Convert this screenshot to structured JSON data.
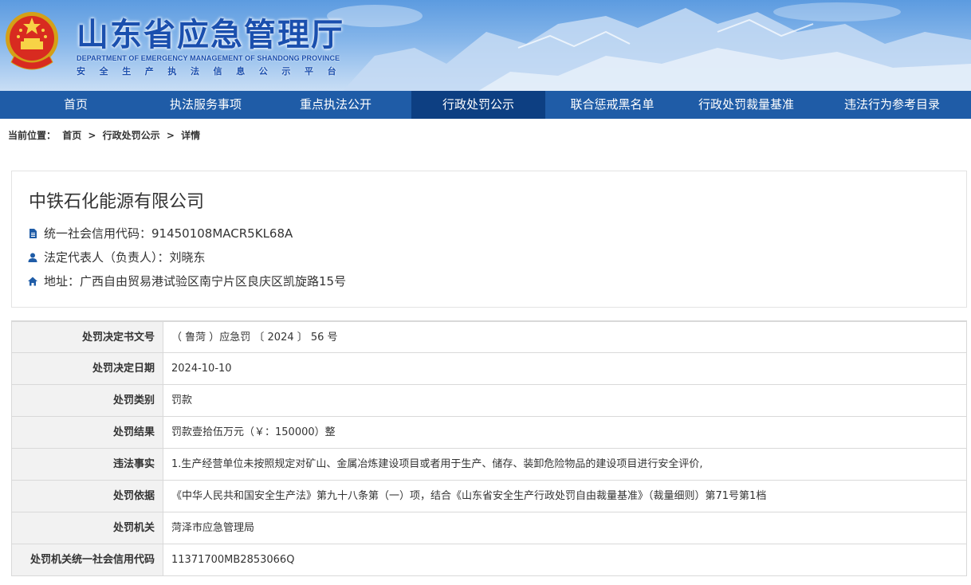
{
  "header": {
    "title_cn": "山东省应急管理厅",
    "title_en": "DEPARTMENT OF EMERGENCY MANAGEMENT OF SHANDONG PROVINCE",
    "subtitle": "安全生产执法信息公示平台",
    "brand_color": "#1a4fae"
  },
  "nav": {
    "items": [
      {
        "label": "首页"
      },
      {
        "label": "执法服务事项"
      },
      {
        "label": "重点执法公开"
      },
      {
        "label": "行政处罚公示"
      },
      {
        "label": "联合惩戒黑名单"
      },
      {
        "label": "行政处罚裁量基准"
      },
      {
        "label": "违法行为参考目录"
      }
    ],
    "active_index": 3,
    "bg_color": "#1f5ca7",
    "active_color": "#0d3f82"
  },
  "breadcrumb": {
    "prefix": "当前位置：",
    "items": [
      "首页",
      "行政处罚公示",
      "详情"
    ],
    "separator": ">"
  },
  "company": {
    "name": "中铁石化能源有限公司",
    "credit_code": "统一社会信用代码：91450108MACR5KL68A",
    "legal_rep": "法定代表人（负责人）：刘晓东",
    "address": "地址：广西自由贸易港试验区南宁片区良庆区凯旋路15号",
    "icons": [
      "document-icon",
      "user-icon",
      "home-icon"
    ]
  },
  "details": [
    {
      "key": "处罚决定书文号",
      "value": "（ 鲁菏 ）应急罚 〔 2024 〕 56 号"
    },
    {
      "key": "处罚决定日期",
      "value": "2024-10-10"
    },
    {
      "key": "处罚类别",
      "value": "罚款"
    },
    {
      "key": "处罚结果",
      "value": "罚款壹拾伍万元（￥：150000）整"
    },
    {
      "key": "违法事实",
      "value": "1.生产经营单位未按照规定对矿山、金属冶炼建设项目或者用于生产、储存、装卸危险物品的建设项目进行安全评价,"
    },
    {
      "key": "处罚依据",
      "value": "《中华人民共和国安全生产法》第九十八条第（一）项，结合《山东省安全生产行政处罚自由裁量基准》（裁量细则）第71号第1档"
    },
    {
      "key": "处罚机关",
      "value": "菏泽市应急管理局"
    },
    {
      "key": "处罚机关统一社会信用代码",
      "value": "11371700MB2853066Q"
    }
  ]
}
